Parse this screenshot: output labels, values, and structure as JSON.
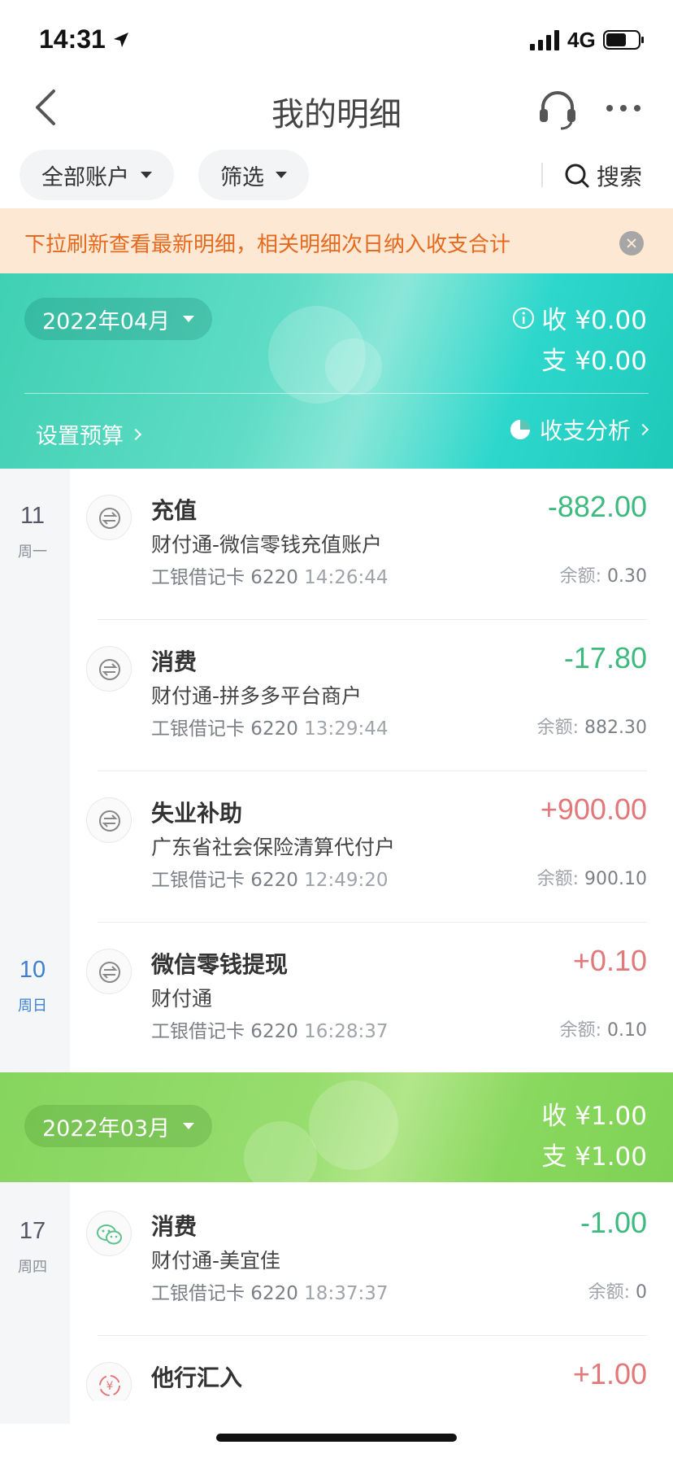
{
  "status_bar": {
    "time": "14:31",
    "network": "4G"
  },
  "nav": {
    "title": "我的明细"
  },
  "filters": {
    "account_label": "全部账户",
    "filter_label": "筛选",
    "search_label": "搜索"
  },
  "notice": {
    "text": "下拉刷新查看最新明细，相关明细次日纳入收支合计"
  },
  "months": [
    {
      "label": "2022年04月",
      "income": "收 ¥0.00",
      "expense": "支 ¥0.00",
      "budget_link": "设置预算",
      "analysis_link": "收支分析",
      "colors": {
        "start": "#3fd0b2",
        "end": "#1ec9b9"
      }
    },
    {
      "label": "2022年03月",
      "income": "收 ¥1.00",
      "expense": "支 ¥1.00",
      "colors": {
        "start": "#86d55e",
        "end": "#7ed255"
      }
    }
  ],
  "days": [
    {
      "day": "11",
      "weekday": "周一"
    },
    {
      "day": "10",
      "weekday": "周日"
    },
    {
      "day": "17",
      "weekday": "周四"
    }
  ],
  "transactions": [
    {
      "title": "充值",
      "party": "财付通-微信零钱充值账户",
      "card": "工银借记卡 6220",
      "time": "14:26:44",
      "amount": "-882.00",
      "balance_label": "余额:",
      "balance": "0.30",
      "icon": "transfer-icon"
    },
    {
      "title": "消费",
      "party": "财付通-拼多多平台商户",
      "card": "工银借记卡 6220",
      "time": "13:29:44",
      "amount": "-17.80",
      "balance_label": "余额:",
      "balance": "882.30",
      "icon": "transfer-icon"
    },
    {
      "title": "失业补助",
      "party": "广东省社会保险清算代付户",
      "card": "工银借记卡 6220",
      "time": "12:49:20",
      "amount": "+900.00",
      "balance_label": "余额:",
      "balance": "900.10",
      "icon": "transfer-icon"
    },
    {
      "title": "微信零钱提现",
      "party": "财付通",
      "card": "工银借记卡 6220",
      "time": "16:28:37",
      "amount": "+0.10",
      "balance_label": "余额:",
      "balance": "0.10",
      "icon": "transfer-icon"
    },
    {
      "title": "消费",
      "party": "财付通-美宜佳",
      "card": "工银借记卡 6220",
      "time": "18:37:37",
      "amount": "-1.00",
      "balance_label": "余额:",
      "balance": "0",
      "icon": "wechat-icon"
    },
    {
      "title": "他行汇入",
      "amount": "+1.00",
      "icon": "yuan-icon"
    }
  ],
  "theme": {
    "expense_color": "#3dba7e",
    "income_color": "#e2787a",
    "notice_color": "#e5691f"
  }
}
